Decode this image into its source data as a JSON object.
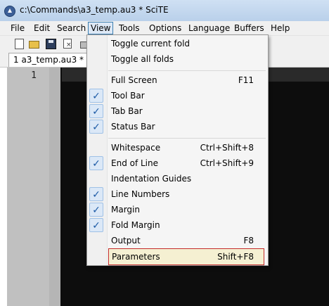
{
  "window": {
    "title": "c:\\Commands\\a3_temp.au3 * SciTE"
  },
  "menubar": {
    "items": [
      "File",
      "Edit",
      "Search",
      "View",
      "Tools",
      "Options",
      "Language",
      "Buffers",
      "Help"
    ],
    "active": "View"
  },
  "toolbar": {
    "buttons": [
      "new-icon",
      "open-icon",
      "save-icon",
      "close-file-icon",
      "print-icon"
    ]
  },
  "tabs": [
    {
      "label": "1 a3_temp.au3 *"
    }
  ],
  "editor": {
    "line_numbers": [
      "1"
    ]
  },
  "view_menu": {
    "items": [
      {
        "label": "Toggle current fold",
        "accel": "",
        "checked": false
      },
      {
        "label": "Toggle all folds",
        "accel": "",
        "checked": false
      },
      {
        "label": "Full Screen",
        "accel": "F11",
        "checked": false
      },
      {
        "label": "Tool Bar",
        "accel": "",
        "checked": true
      },
      {
        "label": "Tab Bar",
        "accel": "",
        "checked": true
      },
      {
        "label": "Status Bar",
        "accel": "",
        "checked": true
      },
      {
        "label": "Whitespace",
        "accel": "Ctrl+Shift+8",
        "checked": false
      },
      {
        "label": "End of Line",
        "accel": "Ctrl+Shift+9",
        "checked": true
      },
      {
        "label": "Indentation Guides",
        "accel": "",
        "checked": false
      },
      {
        "label": "Line Numbers",
        "accel": "",
        "checked": true
      },
      {
        "label": "Margin",
        "accel": "",
        "checked": true
      },
      {
        "label": "Fold Margin",
        "accel": "",
        "checked": true
      },
      {
        "label": "Output",
        "accel": "F8",
        "checked": false
      },
      {
        "label": "Parameters",
        "accel": "Shift+F8",
        "checked": false,
        "highlighted": true
      }
    ],
    "check_glyph": "✓"
  },
  "colors": {
    "highlight_border": "#c42b2b",
    "check_bg": "#dbe8f7",
    "editor_bg": "#0d0d0d"
  }
}
